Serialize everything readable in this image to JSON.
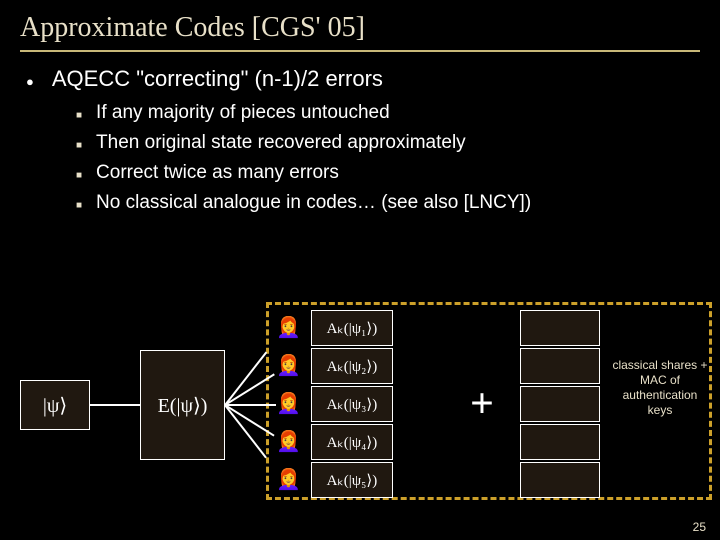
{
  "title": "Approximate Codes [CGS' 05]",
  "main_bullet": "AQECC \"correcting\" (n-1)/2 errors",
  "sub_bullets": [
    "If any majority of pieces untouched",
    "Then original state recovered approximately",
    "Correct twice as many errors",
    "No classical analogue in codes… (see also [LNCY])"
  ],
  "diagram": {
    "psi": "|ψ⟩",
    "E_label": "E(|ψ⟩)",
    "Ak_labels": [
      "Aₖ(|ψ₁⟩)",
      "Aₖ(|ψ₂⟩)",
      "Aₖ(|ψ₃⟩)",
      "Aₖ(|ψ₄⟩)",
      "Aₖ(|ψ₅⟩)"
    ],
    "plus": "+",
    "classical_label": "classical shares + MAC of authentication keys"
  },
  "page_number": "25",
  "emoji": "👩‍🦰"
}
